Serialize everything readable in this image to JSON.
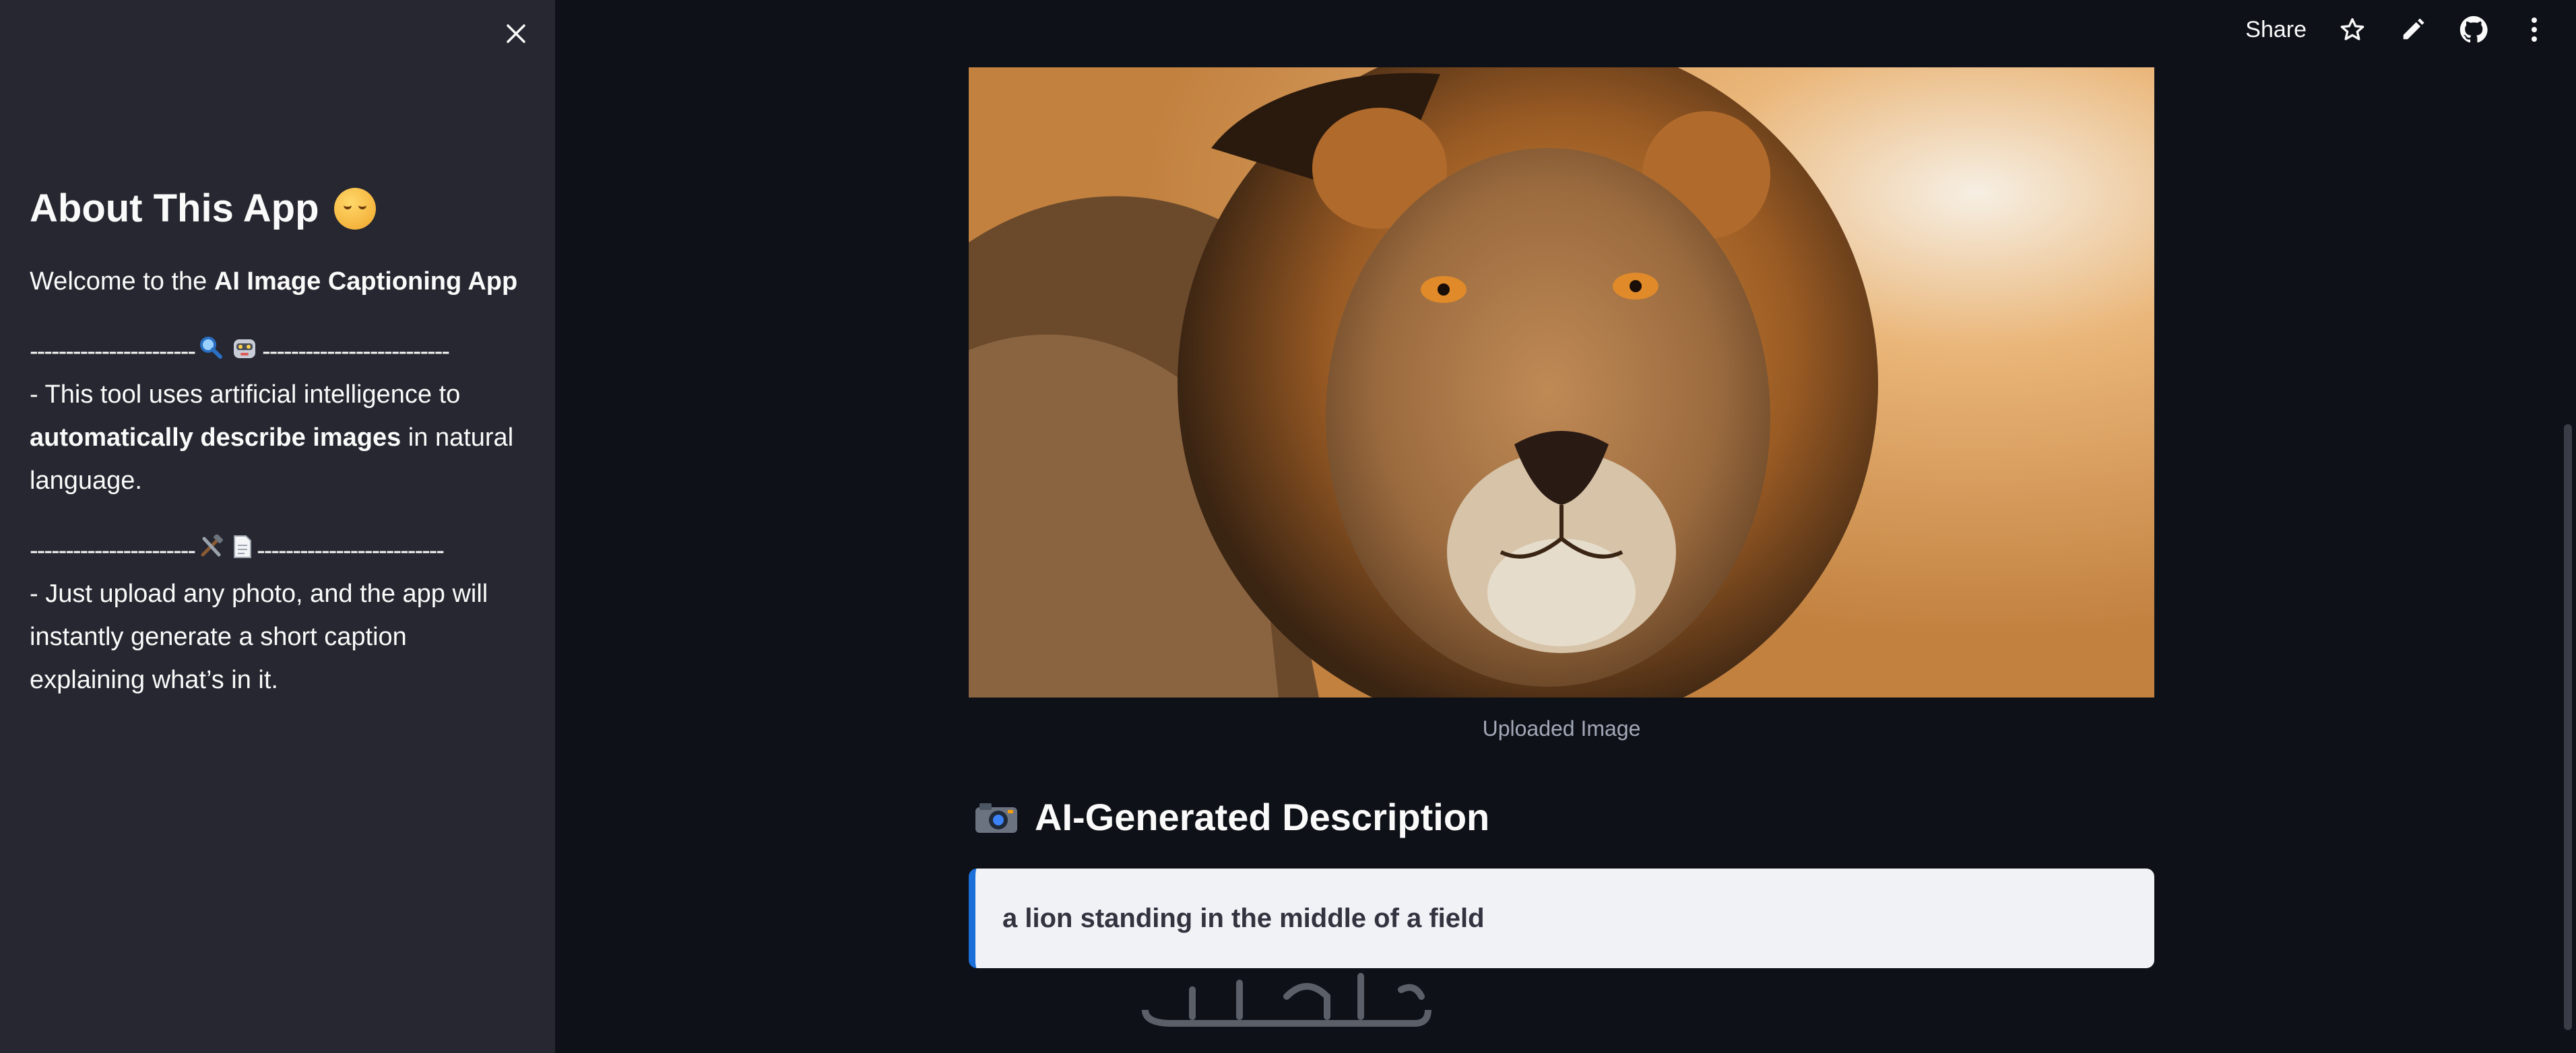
{
  "sidebar": {
    "title": "About This App",
    "title_emoji_icon": "hugging-face-emoji-icon",
    "welcome_prefix": "Welcome to the ",
    "welcome_bold": "AI Image Captioning App",
    "divider_left": "-----------------------",
    "divider_right": "--------------------------",
    "divider1_icons": [
      "magnifier-icon",
      "robot-icon"
    ],
    "divider2_icons": [
      "hammer-wrench-icon",
      "document-icon"
    ],
    "para1_prefix": "- This tool uses artificial intelligence to ",
    "para1_bold": "automatically describe images",
    "para1_suffix": " in natural language.",
    "para2": "- Just upload any photo, and the app will instantly generate a short caption explaining what’s in it."
  },
  "toolbar": {
    "share_label": "Share"
  },
  "main": {
    "image_caption": "Uploaded Image",
    "heading": "AI-Generated Description",
    "description": "a lion standing in the middle of a field"
  },
  "colors": {
    "background": "#0e1117",
    "sidebar": "#262730",
    "info_box": "#f0f2f6",
    "info_border": "#1c6ed8",
    "text": "#fafafa"
  }
}
